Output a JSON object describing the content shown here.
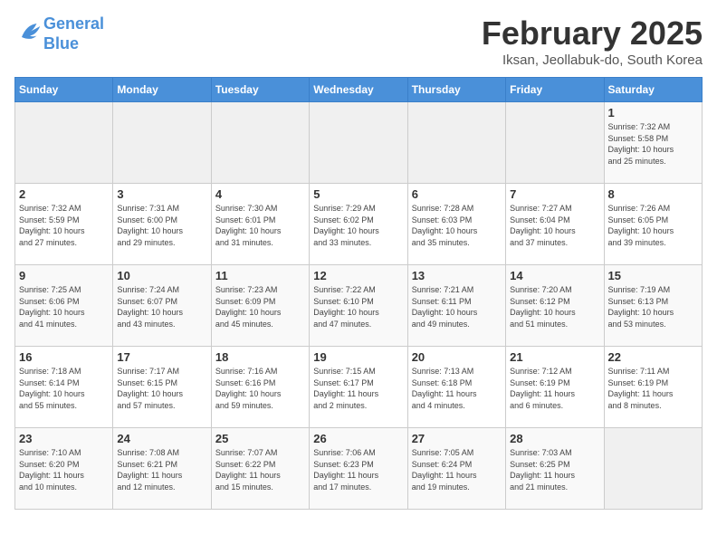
{
  "header": {
    "logo_line1": "General",
    "logo_line2": "Blue",
    "month_title": "February 2025",
    "location": "Iksan, Jeollabuk-do, South Korea"
  },
  "weekdays": [
    "Sunday",
    "Monday",
    "Tuesday",
    "Wednesday",
    "Thursday",
    "Friday",
    "Saturday"
  ],
  "weeks": [
    [
      {
        "day": "",
        "info": ""
      },
      {
        "day": "",
        "info": ""
      },
      {
        "day": "",
        "info": ""
      },
      {
        "day": "",
        "info": ""
      },
      {
        "day": "",
        "info": ""
      },
      {
        "day": "",
        "info": ""
      },
      {
        "day": "1",
        "info": "Sunrise: 7:32 AM\nSunset: 5:58 PM\nDaylight: 10 hours\nand 25 minutes."
      }
    ],
    [
      {
        "day": "2",
        "info": "Sunrise: 7:32 AM\nSunset: 5:59 PM\nDaylight: 10 hours\nand 27 minutes."
      },
      {
        "day": "3",
        "info": "Sunrise: 7:31 AM\nSunset: 6:00 PM\nDaylight: 10 hours\nand 29 minutes."
      },
      {
        "day": "4",
        "info": "Sunrise: 7:30 AM\nSunset: 6:01 PM\nDaylight: 10 hours\nand 31 minutes."
      },
      {
        "day": "5",
        "info": "Sunrise: 7:29 AM\nSunset: 6:02 PM\nDaylight: 10 hours\nand 33 minutes."
      },
      {
        "day": "6",
        "info": "Sunrise: 7:28 AM\nSunset: 6:03 PM\nDaylight: 10 hours\nand 35 minutes."
      },
      {
        "day": "7",
        "info": "Sunrise: 7:27 AM\nSunset: 6:04 PM\nDaylight: 10 hours\nand 37 minutes."
      },
      {
        "day": "8",
        "info": "Sunrise: 7:26 AM\nSunset: 6:05 PM\nDaylight: 10 hours\nand 39 minutes."
      }
    ],
    [
      {
        "day": "9",
        "info": "Sunrise: 7:25 AM\nSunset: 6:06 PM\nDaylight: 10 hours\nand 41 minutes."
      },
      {
        "day": "10",
        "info": "Sunrise: 7:24 AM\nSunset: 6:07 PM\nDaylight: 10 hours\nand 43 minutes."
      },
      {
        "day": "11",
        "info": "Sunrise: 7:23 AM\nSunset: 6:09 PM\nDaylight: 10 hours\nand 45 minutes."
      },
      {
        "day": "12",
        "info": "Sunrise: 7:22 AM\nSunset: 6:10 PM\nDaylight: 10 hours\nand 47 minutes."
      },
      {
        "day": "13",
        "info": "Sunrise: 7:21 AM\nSunset: 6:11 PM\nDaylight: 10 hours\nand 49 minutes."
      },
      {
        "day": "14",
        "info": "Sunrise: 7:20 AM\nSunset: 6:12 PM\nDaylight: 10 hours\nand 51 minutes."
      },
      {
        "day": "15",
        "info": "Sunrise: 7:19 AM\nSunset: 6:13 PM\nDaylight: 10 hours\nand 53 minutes."
      }
    ],
    [
      {
        "day": "16",
        "info": "Sunrise: 7:18 AM\nSunset: 6:14 PM\nDaylight: 10 hours\nand 55 minutes."
      },
      {
        "day": "17",
        "info": "Sunrise: 7:17 AM\nSunset: 6:15 PM\nDaylight: 10 hours\nand 57 minutes."
      },
      {
        "day": "18",
        "info": "Sunrise: 7:16 AM\nSunset: 6:16 PM\nDaylight: 10 hours\nand 59 minutes."
      },
      {
        "day": "19",
        "info": "Sunrise: 7:15 AM\nSunset: 6:17 PM\nDaylight: 11 hours\nand 2 minutes."
      },
      {
        "day": "20",
        "info": "Sunrise: 7:13 AM\nSunset: 6:18 PM\nDaylight: 11 hours\nand 4 minutes."
      },
      {
        "day": "21",
        "info": "Sunrise: 7:12 AM\nSunset: 6:19 PM\nDaylight: 11 hours\nand 6 minutes."
      },
      {
        "day": "22",
        "info": "Sunrise: 7:11 AM\nSunset: 6:19 PM\nDaylight: 11 hours\nand 8 minutes."
      }
    ],
    [
      {
        "day": "23",
        "info": "Sunrise: 7:10 AM\nSunset: 6:20 PM\nDaylight: 11 hours\nand 10 minutes."
      },
      {
        "day": "24",
        "info": "Sunrise: 7:08 AM\nSunset: 6:21 PM\nDaylight: 11 hours\nand 12 minutes."
      },
      {
        "day": "25",
        "info": "Sunrise: 7:07 AM\nSunset: 6:22 PM\nDaylight: 11 hours\nand 15 minutes."
      },
      {
        "day": "26",
        "info": "Sunrise: 7:06 AM\nSunset: 6:23 PM\nDaylight: 11 hours\nand 17 minutes."
      },
      {
        "day": "27",
        "info": "Sunrise: 7:05 AM\nSunset: 6:24 PM\nDaylight: 11 hours\nand 19 minutes."
      },
      {
        "day": "28",
        "info": "Sunrise: 7:03 AM\nSunset: 6:25 PM\nDaylight: 11 hours\nand 21 minutes."
      },
      {
        "day": "",
        "info": ""
      }
    ]
  ]
}
